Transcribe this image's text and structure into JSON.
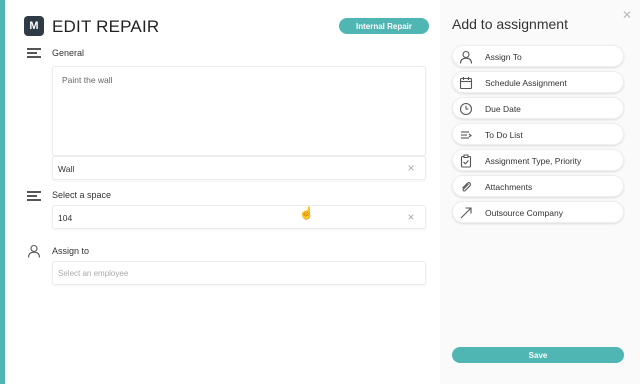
{
  "header": {
    "badge_letter": "M",
    "title": "EDIT REPAIR",
    "type_pill": "Internal Repair"
  },
  "general": {
    "label": "General",
    "description": "Paint the wall",
    "location_value": "Wall"
  },
  "space": {
    "label": "Select a space",
    "value": "104"
  },
  "assign": {
    "label": "Assign to",
    "placeholder": "Select an employee"
  },
  "sidebar": {
    "title": "Add to assignment",
    "actions": [
      {
        "label": "Assign To",
        "icon": "person-icon"
      },
      {
        "label": "Schedule Assignment",
        "icon": "calendar-icon"
      },
      {
        "label": "Due Date",
        "icon": "clock-icon"
      },
      {
        "label": "To Do List",
        "icon": "list-icon"
      },
      {
        "label": "Assignment Type, Priority",
        "icon": "clipboard-icon"
      },
      {
        "label": "Attachments",
        "icon": "paperclip-icon"
      },
      {
        "label": "Outsource Company",
        "icon": "arrow-out-icon"
      }
    ],
    "save_label": "Save"
  },
  "colors": {
    "accent": "#4fb6b3",
    "badge_bg": "#2e3a45"
  }
}
